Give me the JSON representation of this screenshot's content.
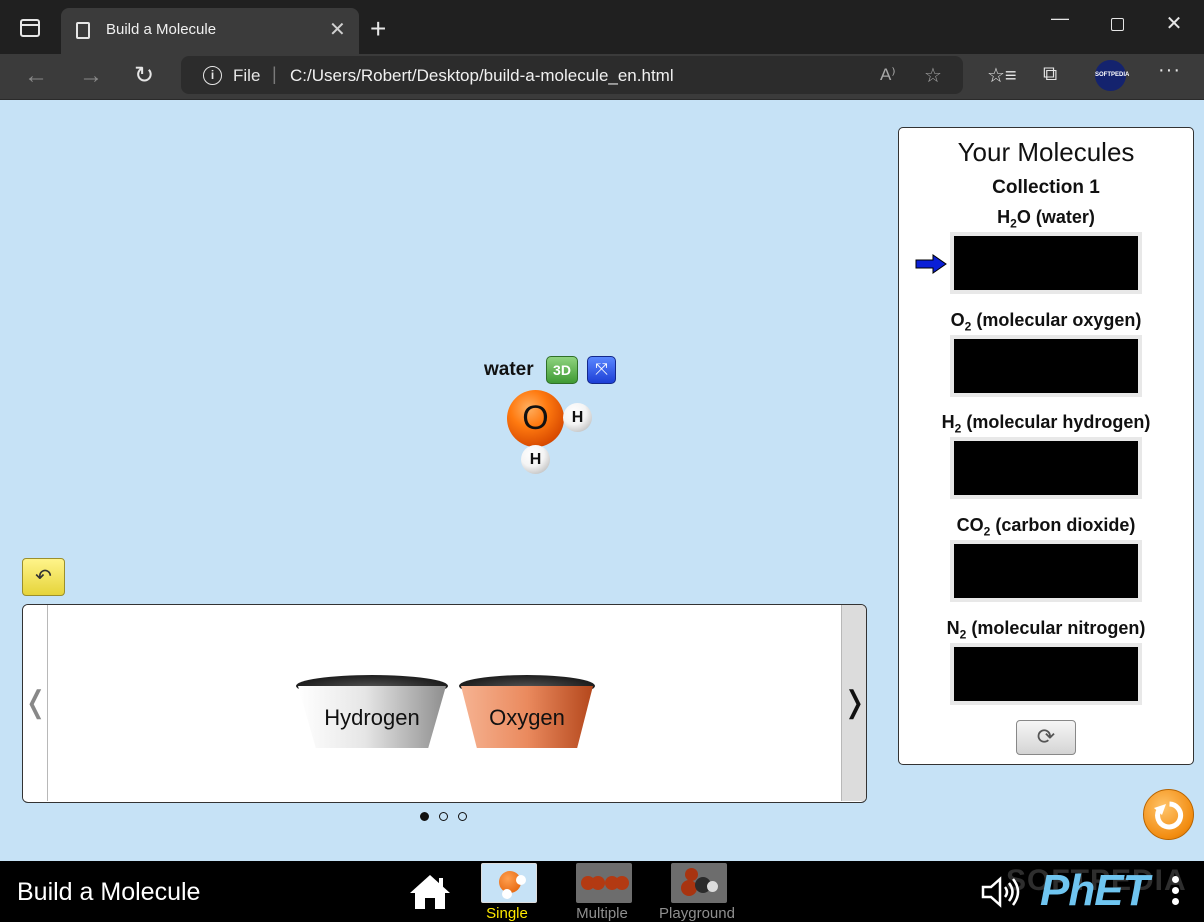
{
  "browser": {
    "tab_title": "Build a Molecule",
    "tab_close_glyph": "✕",
    "new_tab_glyph": "+",
    "url_scheme": "File",
    "url_separator": "|",
    "url": "C:/Users/Robert/Desktop/build-a-molecule_en.html",
    "profile_label": "SOFTPEDIA",
    "window_controls": {
      "minimize": "—",
      "close": "✕"
    },
    "icons": {
      "back": "back-arrow-icon",
      "forward": "forward-arrow-icon",
      "reload": "reload-icon",
      "read_aloud": "read-aloud-icon",
      "add_favorite": "add-favorite-icon",
      "favorites": "favorites-icon",
      "collections": "collections-icon",
      "more": "more-icon"
    },
    "glyphs": {
      "back": "←",
      "forward": "→",
      "reload": "↻",
      "info": "i",
      "read_aloud": "A⁾",
      "add_favorite": "☆",
      "favorites": "☆≡",
      "collections": "⧉",
      "more": "···"
    }
  },
  "play_area": {
    "molecule_name": "water",
    "btn_3d_label": "3D",
    "break_glyph": "⤧",
    "atoms": {
      "oxygen": "O",
      "hydrogen_1": "H",
      "hydrogen_2": "H"
    }
  },
  "kit": {
    "reset_kit_glyph": "↶",
    "prev_glyph": "❬",
    "next_glyph": "❭",
    "buckets": [
      "Hydrogen",
      "Oxygen"
    ],
    "page_count": 3,
    "current_page": 1
  },
  "collection": {
    "title": "Your Molecules",
    "subtitle": "Collection 1",
    "targets": [
      {
        "pre": "H",
        "sub": "2",
        "post": "O (water)",
        "filled": false,
        "current": true
      },
      {
        "pre": "O",
        "sub": "2",
        "post": " (molecular oxygen)",
        "filled": false,
        "current": false
      },
      {
        "pre": "H",
        "sub": "2",
        "post": " (molecular hydrogen)",
        "filled": false,
        "current": false
      },
      {
        "pre": "CO",
        "sub": "2",
        "post": " (carbon dioxide)",
        "filled": false,
        "current": false
      },
      {
        "pre": "N",
        "sub": "2",
        "post": " (molecular nitrogen)",
        "filled": false,
        "current": false
      }
    ],
    "refresh_glyph": "⟳"
  },
  "navbar": {
    "sim_title": "Build a Molecule",
    "screens": [
      {
        "label": "Single",
        "active": true
      },
      {
        "label": "Multiple",
        "active": false
      },
      {
        "label": "Playground",
        "active": false
      }
    ],
    "logo": "PhET",
    "watermark": "SOFTPEDIA"
  },
  "colors": {
    "sim_background": "#c6e2f6",
    "oxygen": "#ff7a10",
    "hydrogen": "#f4f4f4",
    "active_screen_label": "#ffea00",
    "phet_logo": "#6fc5f0",
    "target_arrow": "#0a1fd6"
  }
}
